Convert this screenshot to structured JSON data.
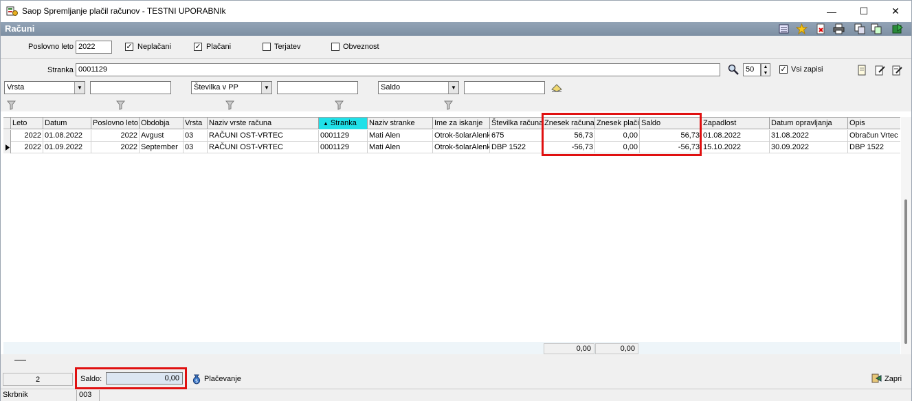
{
  "window": {
    "title": "Saop Spremljanje plačil računov - TESTNI UPORABNIk",
    "minimize": "—",
    "maximize": "☐",
    "close": "✕"
  },
  "header": {
    "title": "Računi"
  },
  "filters": {
    "poslovno_leto_label": "Poslovno leto",
    "poslovno_leto_value": "2022",
    "neplacani_label": "Neplačani",
    "neplacani_checked": "✓",
    "placani_label": "Plačani",
    "placani_checked": "✓",
    "terjatev_label": "Terjatev",
    "obveznost_label": "Obveznost",
    "stranka_label": "Stranka",
    "stranka_value": "0001129",
    "limit_value": "50",
    "vsi_zapisi_label": "Vsi zapisi",
    "vsi_zapisi_checked": "✓",
    "combo1": "Vrsta",
    "combo2": "Številka v PP",
    "combo3": "Saldo"
  },
  "grid": {
    "columns": [
      "Leto",
      "Datum",
      "Poslovno leto",
      "Obdobja",
      "Vrsta",
      "Naziv vrste računa",
      "Stranka",
      "Naziv stranke",
      "Ime za iskanje",
      "Številka računa",
      "Znesek računa",
      "Znesek plačil",
      "Saldo",
      "Zapadlost",
      "Datum opravljanja",
      "Opis"
    ],
    "sorted_marker": "▲",
    "rows": [
      [
        "2022",
        "01.08.2022",
        "2022",
        "Avgust",
        "03",
        "RAČUNI OST-VRTEC",
        "0001129",
        "Mati Alen",
        "Otrok-šolarAlenk",
        "675",
        "56,73",
        "0,00",
        "56,73",
        "01.08.2022",
        "31.08.2022",
        "Obračun Vrtec"
      ],
      [
        "2022",
        "01.09.2022",
        "2022",
        "September",
        "03",
        "RAČUNI OST-VRTEC",
        "0001129",
        "Mati Alen",
        "Otrok-šolarAlenk",
        "DBP 1522",
        "-56,73",
        "0,00",
        "-56,73",
        "15.10.2022",
        "30.09.2022",
        "DBP 1522"
      ]
    ],
    "totals": {
      "znesek_racuna": "0,00",
      "znesek_placil": "0,00"
    }
  },
  "bottom": {
    "count": "2",
    "saldo_label": "Saldo:",
    "saldo_value": "0,00",
    "placevanje_label": "Plačevanje",
    "zapri_label": "Zapri"
  },
  "statusbar": {
    "user_label": "Skrbnik",
    "code": "003"
  },
  "colors": {
    "sorted_header": "#20e0e8",
    "highlight": "#e01010",
    "header_band": "#8a9bad"
  }
}
